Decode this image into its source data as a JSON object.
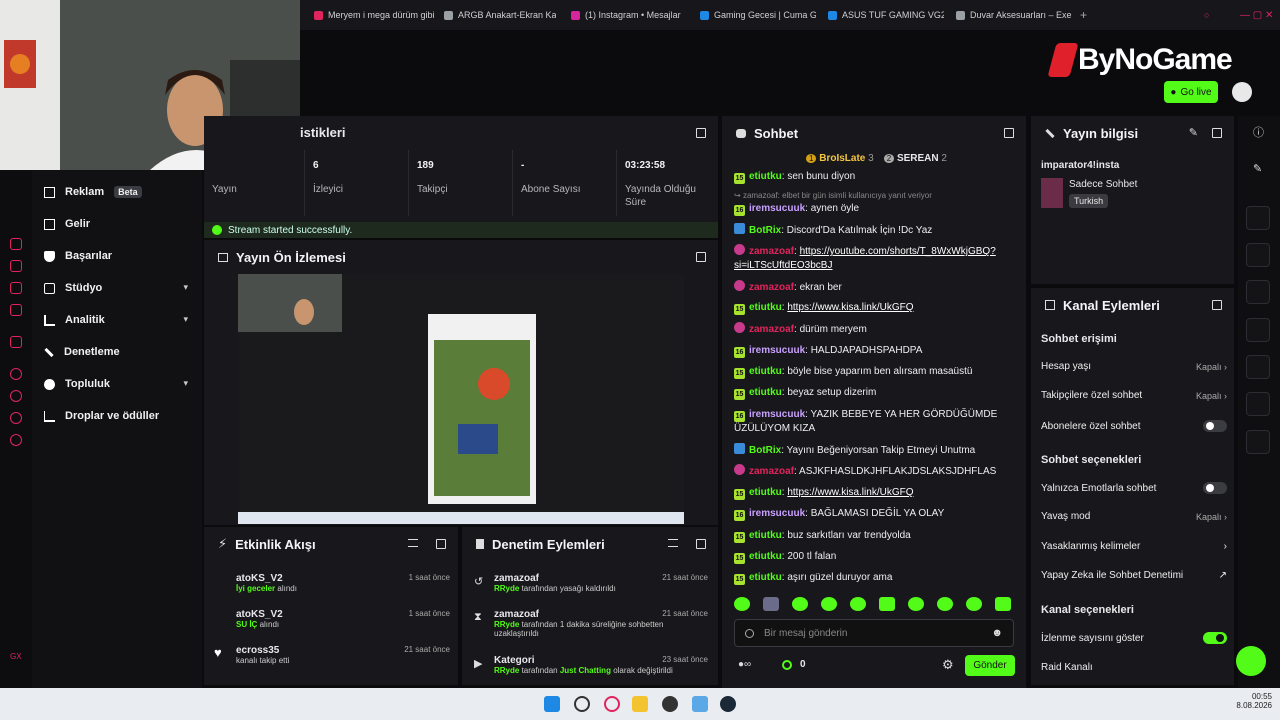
{
  "browser_tabs": [
    {
      "title": "Meryem i mega dürüm gibi",
      "color": "#e0245e"
    },
    {
      "title": "ARGB Anakart-Ekran Kartı",
      "color": "#9aa0a6"
    },
    {
      "title": "(1) Instagram • Mesajlar",
      "color": "#d6249f"
    },
    {
      "title": "Gaming Gecesi | Cuma Ge",
      "color": "#1e88e5"
    },
    {
      "title": "ASUS TUF GAMING VG24",
      "color": "#1e88e5"
    },
    {
      "title": "Duvar Aksesuarları – Exem",
      "color": "#9aa0a6"
    }
  ],
  "browser": {
    "ai_label": "AI"
  },
  "brand": {
    "logo_text": "ByNoGame",
    "go_live": "Go live"
  },
  "leftnav": {
    "items": [
      {
        "label": "Reklam",
        "badge": "Beta"
      },
      {
        "label": "Gelir"
      },
      {
        "label": "Başarılar"
      },
      {
        "label": "Stüdyo"
      },
      {
        "label": "Analitik"
      },
      {
        "label": "Denetleme"
      },
      {
        "label": "Topluluk"
      },
      {
        "label": "Droplar ve ödüller"
      }
    ]
  },
  "stats": {
    "title": "istikleri",
    "cells": [
      {
        "value": "6",
        "label": "İzleyici"
      },
      {
        "value": "189",
        "label": "Takipçi"
      },
      {
        "value": "-",
        "label": "Abone Sayısı"
      },
      {
        "value": "03:23:58",
        "label": "Yayında Olduğu Süre"
      }
    ],
    "first_label": "Yayın",
    "success": "Stream started successfully."
  },
  "preview": {
    "title": "Yayın Ön İzlemesi"
  },
  "activity": {
    "title": "Etkinlik Akışı",
    "items": [
      {
        "user": "atoKS_V2",
        "time": "1 saat önce",
        "item": "İyi geceler",
        "suffix": "alındı"
      },
      {
        "user": "atoKS_V2",
        "time": "1 saat önce",
        "item": "SU İÇ",
        "suffix": "alındı"
      },
      {
        "user": "ecross35",
        "time": "21 saat önce",
        "item": "",
        "suffix": "kanalı takip etti"
      }
    ]
  },
  "moderation": {
    "title": "Denetim Eylemleri",
    "items": [
      {
        "user": "zamazoaf",
        "time": "21 saat önce",
        "actor": "RRyde",
        "text": "tarafından yasağı kaldırıldı"
      },
      {
        "user": "zamazoaf",
        "time": "21 saat önce",
        "actor": "RRyde",
        "text": "tarafından 1 dakika süreliğine sohbetten uzaklaştırıldı"
      },
      {
        "user": "Kategori",
        "time": "23 saat önce",
        "actor": "RRyde",
        "text": "tarafından",
        "highlight": "Just Chatting",
        "text2": "olarak değiştirildi"
      }
    ]
  },
  "chat": {
    "title": "Sohbet",
    "leaders": [
      {
        "rank": "1",
        "name": "BroIsLate",
        "count": "3"
      },
      {
        "rank": "2",
        "name": "SEREAN",
        "count": "2"
      }
    ],
    "reply_note": "zamazoaf: elbet bir gün isimli kullanıcıya yanıt veriyor",
    "messages": [
      {
        "b": "15",
        "u": "etiutku",
        "uc": "#53fc18",
        "t": "sen bunu diyon"
      },
      {
        "b": "16",
        "u": "iremsucuuk",
        "uc": "#c9a0ff",
        "t": "aynen öyle"
      },
      {
        "b": "bot",
        "u": "BotRix",
        "uc": "#53fc18",
        "t": "Discord'Da Katılmak İçin !Dc Yaz"
      },
      {
        "b": "p",
        "u": "zamazoaf",
        "uc": "#e0245e",
        "t": "https://youtube.com/shorts/T_8WxWkjGBQ?si=iLTScUftdEO3bcBJ",
        "link": true
      },
      {
        "b": "p",
        "u": "zamazoaf",
        "uc": "#e0245e",
        "t": "ekran ber"
      },
      {
        "b": "15",
        "u": "etiutku",
        "uc": "#53fc18",
        "t": "https://www.kisa.link/UkGFQ",
        "link": true
      },
      {
        "b": "p",
        "u": "zamazoaf",
        "uc": "#e0245e",
        "t": "dürüm meryem"
      },
      {
        "b": "16",
        "u": "iremsucuuk",
        "uc": "#c9a0ff",
        "t": "HALDJAPADHSPAHDPA"
      },
      {
        "b": "15",
        "u": "etiutku",
        "uc": "#53fc18",
        "t": "böyle bise yaparım ben alırsam masaüstü"
      },
      {
        "b": "15",
        "u": "etiutku",
        "uc": "#53fc18",
        "t": "beyaz setup dizerim"
      },
      {
        "b": "16",
        "u": "iremsucuuk",
        "uc": "#c9a0ff",
        "t": "YAZIK BEBEYE YA HER GÖRDÜĞÜMDE ÜZÜLÜYOM KIZA"
      },
      {
        "b": "bot",
        "u": "BotRix",
        "uc": "#53fc18",
        "t": "Yayını Beğeniyorsan Takip Etmeyi Unutma"
      },
      {
        "b": "p",
        "u": "zamazoaf",
        "uc": "#e0245e",
        "t": "ASJKFHASLDKJHFLAKJDSLAKSJDHFLAS"
      },
      {
        "b": "15",
        "u": "etiutku",
        "uc": "#53fc18",
        "t": "https://www.kisa.link/UkGFQ",
        "link": true
      },
      {
        "b": "16",
        "u": "iremsucuuk",
        "uc": "#c9a0ff",
        "t": "BAĞLAMASI DEĞİL YA OLAY"
      },
      {
        "b": "15",
        "u": "etiutku",
        "uc": "#53fc18",
        "t": "buz sarkıtları var trendyolda"
      },
      {
        "b": "15",
        "u": "etiutku",
        "uc": "#53fc18",
        "t": "200 tl falan"
      },
      {
        "b": "15",
        "u": "etiutku",
        "uc": "#53fc18",
        "t": "aşırı güzel duruyor ama"
      }
    ],
    "placeholder": "Bir mesaj gönderin",
    "send": "Gönder",
    "count": "0"
  },
  "info": {
    "title": "Yayın bilgisi",
    "stream_title": "imparator4!insta",
    "category": "Sadece Sohbet",
    "tag": "Turkish"
  },
  "channel": {
    "title": "Kanal Eylemleri",
    "chat_access": "Sohbet erişimi",
    "rows1": [
      {
        "label": "Hesap yaşı",
        "value": "Kapalı"
      },
      {
        "label": "Takipçilere özel sohbet",
        "value": "Kapalı"
      },
      {
        "label": "Abonelere özel sohbet",
        "value": ""
      }
    ],
    "chat_options": "Sohbet seçenekleri",
    "rows2": [
      {
        "label": "Yalnızca Emotlarla sohbet",
        "value": ""
      },
      {
        "label": "Yavaş mod",
        "value": "Kapalı"
      },
      {
        "label": "Yasaklanmış kelimeler",
        "value": ""
      },
      {
        "label": "Yapay Zeka ile Sohbet Denetimi",
        "value": ""
      }
    ],
    "channel_options": "Kanal seçenekleri",
    "rows3": [
      {
        "label": "İzlenme sayısını göster",
        "value": ""
      },
      {
        "label": "Raid Kanalı",
        "value": ""
      }
    ]
  },
  "clock": {
    "time": "00:55",
    "date": "8.08.2026"
  },
  "opera": {
    "label": "GX"
  }
}
